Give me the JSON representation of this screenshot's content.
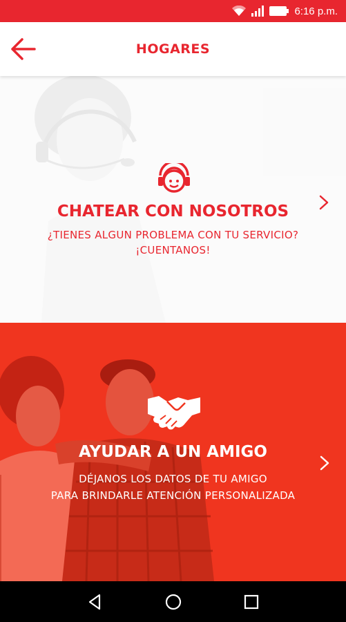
{
  "status_bar": {
    "time": "6:16 p.m."
  },
  "header": {
    "title": "HOGARES"
  },
  "chat_card": {
    "title": "CHATEAR CON NOSOTROS",
    "subtitle_line1": "¿TIENES ALGUN PROBLEMA CON TU SERVICIO?",
    "subtitle_line2": "¡CUENTANOS!"
  },
  "friend_card": {
    "title": "AYUDAR A UN AMIGO",
    "subtitle_line1": "DÉJANOS LOS DATOS DE TU AMIGO",
    "subtitle_line2": "PARA BRINDARLE ATENCIÓN PERSONALIZADA"
  },
  "colors": {
    "brand_red": "#e8262f",
    "card_red": "#f0351f"
  },
  "icons": [
    "wifi-icon",
    "signal-icon",
    "battery-icon",
    "back-arrow-icon",
    "headset-icon",
    "handshake-icon",
    "chevron-right-icon",
    "nav-back-icon",
    "nav-home-icon",
    "nav-recents-icon"
  ]
}
